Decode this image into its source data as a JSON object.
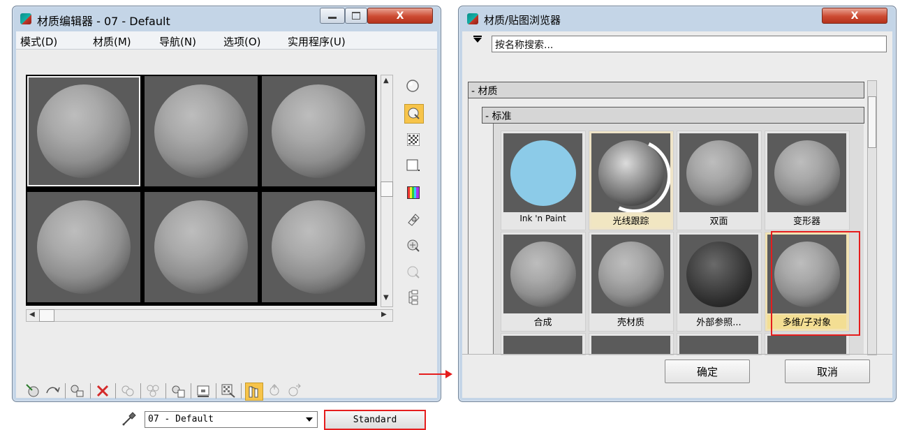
{
  "material_editor": {
    "title": "材质编辑器 - 07 - Default",
    "close_label": "X",
    "menu": [
      "模式(D)",
      "材质(M)",
      "导航(N)",
      "选项(O)",
      "实用程序(U)"
    ],
    "material_name": "07 - Default",
    "material_type_button": "Standard",
    "active_slot_index": 0
  },
  "browser": {
    "title": "材质/贴图浏览器",
    "close_label": "X",
    "search_placeholder": "按名称搜索...",
    "group_materials": "- 材质",
    "group_standard": "- 标准",
    "items": [
      "Ink 'n Paint",
      "光线跟踪",
      "双面",
      "变形器",
      "合成",
      "壳材质",
      "外部参照...",
      "多维/子对象"
    ],
    "selected_item": "多维/子对象",
    "ok_label": "确定",
    "cancel_label": "取消"
  },
  "colors": {
    "highlight_red": "#e51d1d",
    "ink_paint_blue": "#8ccbe8",
    "selected_item_bg": "#f3de93"
  }
}
